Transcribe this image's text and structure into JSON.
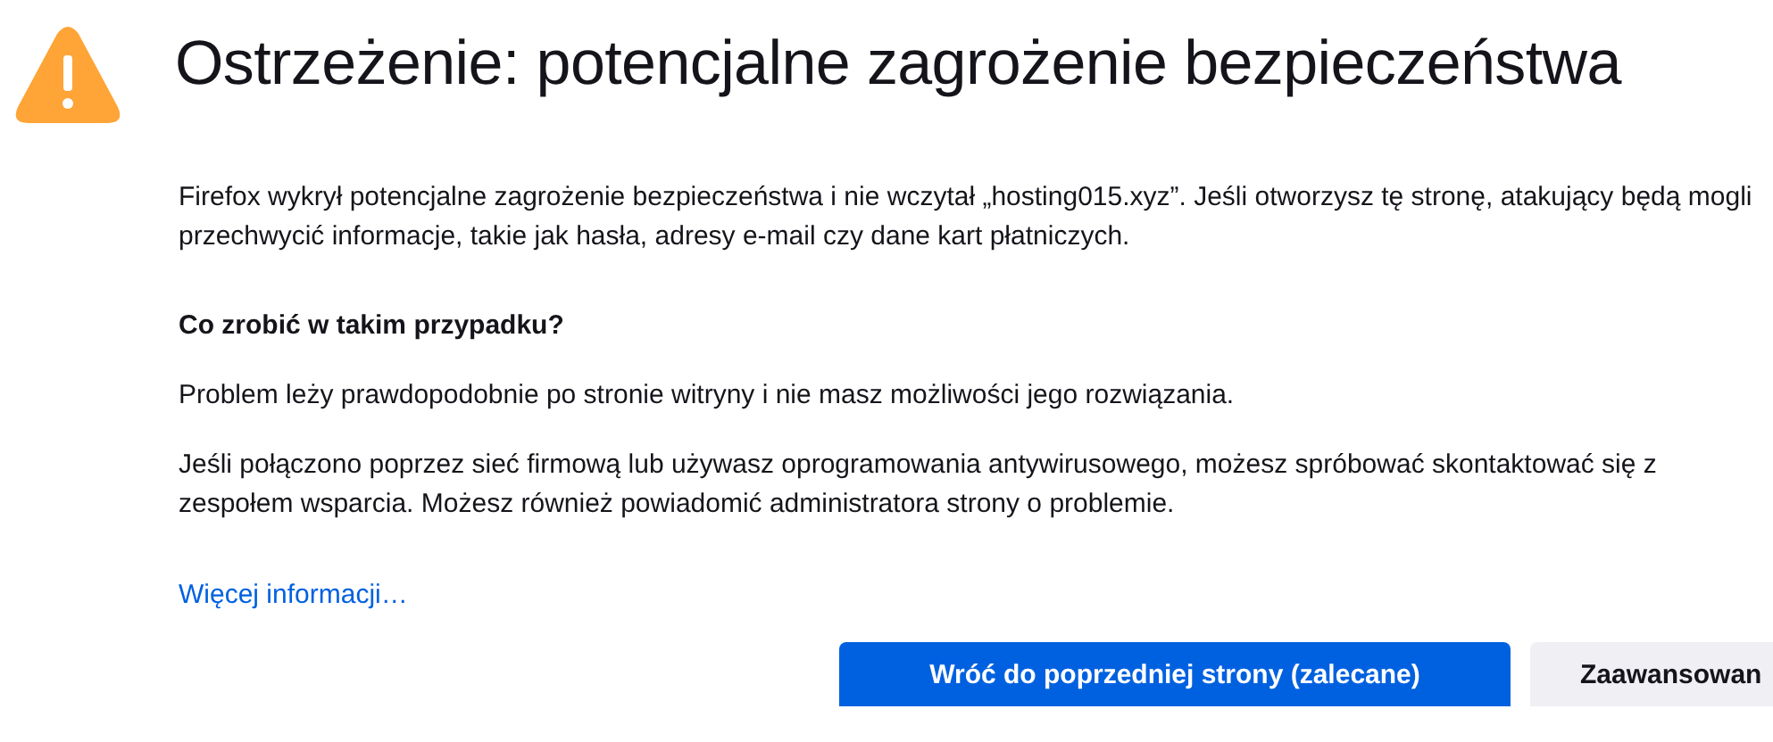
{
  "title": "Ostrzeżenie: potencjalne zagrożenie bezpieczeństwa",
  "intro": "Firefox wykrył potencjalne zagrożenie bezpieczeństwa i nie wczytał „hosting015.xyz”. Jeśli otworzysz tę stronę, atakujący będą mogli przechwycić informacje, takie jak hasła, adresy e-mail czy dane kart płatniczych.",
  "heading": "Co zrobić w takim przypadku?",
  "paragraphs": [
    "Problem leży prawdopodobnie po stronie witryny i nie masz możliwości jego rozwiązania.",
    "Jeśli połączono poprzez sieć firmową lub używasz oprogramowania antywirusowego, możesz spróbować skontaktować się z zespołem wsparcia. Możesz również powiadomić administratora strony o problemie."
  ],
  "link": "Więcej informacji…",
  "buttons": [
    {
      "label": "Wróć do poprzedniej strony (zalecane)",
      "kind": "primary"
    },
    {
      "label": "Zaawansowan",
      "kind": "secondary"
    }
  ]
}
